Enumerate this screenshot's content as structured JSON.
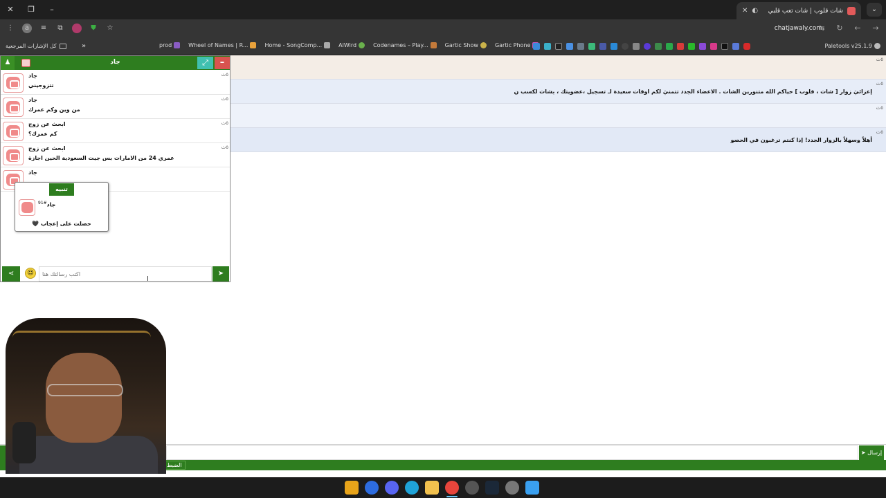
{
  "browser": {
    "tab_title": "شات قلوب | شات تعب قلبي",
    "url": "chatjawaly.com",
    "all_bookmarks_label": "كل الإشارات المرجعية",
    "bookmarks": [
      "prod",
      "Wheel of Names | R...",
      "Home - SongComp...",
      "AlWird",
      "Codenames – Play...",
      "Gartic Show",
      "Gartic Phone"
    ],
    "bookmark_end": "Paletools v25.1.9",
    "colors": {
      "chrome_dark": "#1f1f1f",
      "chrome_bar": "#353535"
    }
  },
  "main_chat": {
    "rows": [
      {
        "text": "",
        "tag": "٥ث"
      },
      {
        "text": "إعزائيَ زوار [ شات ، قلوب ] حياكم الله متنورين الشات . الاعضاء الجدد تتمنيَ لكم اوقات سعيدة لـ تسجيل ،عضويتك ، بشات لكسب ن",
        "tag": "٥ث"
      },
      {
        "text": "",
        "tag": "٥ث"
      },
      {
        "text": "أهلاً وسهلاً بالزوار الجدد! إذا كنتم ترغبون في الحصو",
        "tag": "٥ث"
      }
    ],
    "send_label": "إرسال",
    "settings_label": "الضبط"
  },
  "private_chat": {
    "title": "جاد",
    "accent": "#2e7d1f",
    "messages": [
      {
        "user": "جاد",
        "text": "تتزوجيني",
        "tag": "٥ث"
      },
      {
        "user": "جاد",
        "text": "من وين وكم عمرك",
        "tag": "٥ث"
      },
      {
        "user": "ابحث عن زوج",
        "text": "كم عمرك؟",
        "tag": "٥ث"
      },
      {
        "user": "ابحث عن زوج",
        "text": "عمري 24 من الامارات بس جيت السعودية الحين اجازة",
        "tag": "٥ث"
      },
      {
        "user": "جاد",
        "text": "",
        "tag": ""
      }
    ],
    "input_placeholder": "اكتب رسالتك هنا"
  },
  "alert": {
    "button_label": "تنبيه",
    "user": "جاد",
    "user_sup": "#91",
    "text": "🖤 حصلت على إعجاب"
  }
}
